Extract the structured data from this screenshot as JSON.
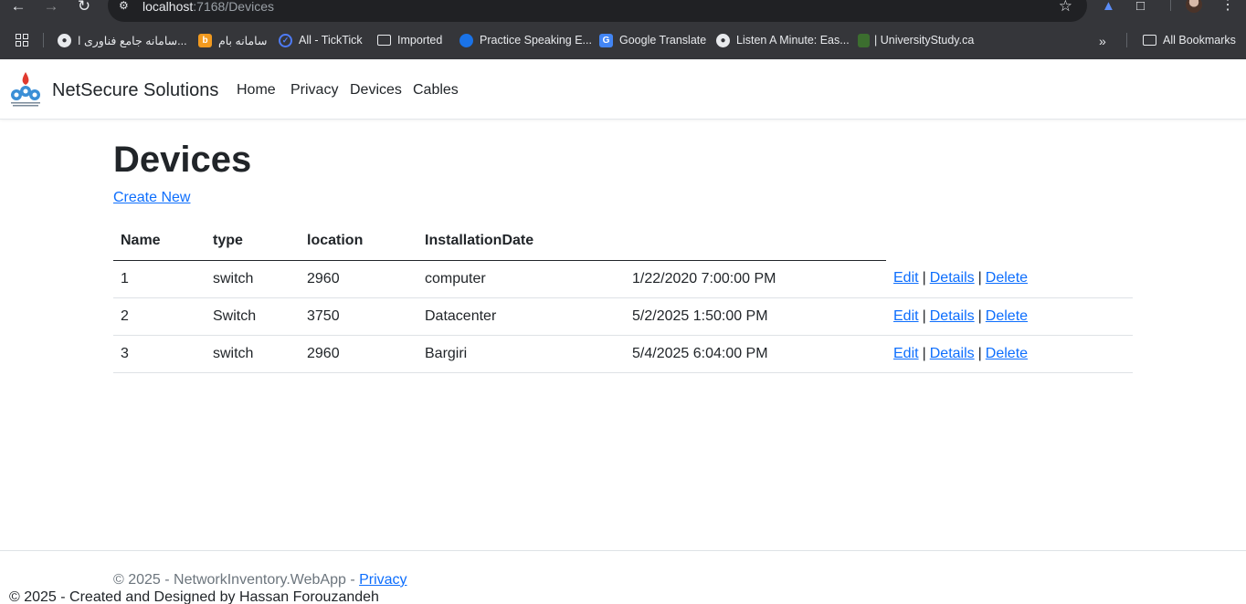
{
  "browser": {
    "url_host": "localhost",
    "url_path": ":7168/Devices",
    "bookmarks": [
      {
        "label": "سامانه جامع فناوری ا...",
        "icon": "globe-icon"
      },
      {
        "label": "سامانه بام",
        "icon": "b-icon"
      },
      {
        "label": "All - TickTick",
        "icon": "ticktick-icon"
      },
      {
        "label": "Imported",
        "icon": "folder-icon"
      },
      {
        "label": "Practice Speaking E...",
        "icon": "blue-circle-icon"
      },
      {
        "label": "Google Translate",
        "icon": "google-translate-icon"
      },
      {
        "label": "Listen A Minute: Eas...",
        "icon": "globe-icon"
      },
      {
        "label": "| UniversityStudy.ca",
        "icon": "graduation-icon"
      }
    ],
    "all_bookmarks": "All Bookmarks"
  },
  "navbar": {
    "brand": "NetSecure Solutions",
    "links": [
      "Home",
      "Privacy",
      "Devices",
      "Cables"
    ]
  },
  "main": {
    "title": "Devices",
    "create_link": "Create New",
    "table": {
      "headers": [
        "Name",
        "type",
        "location",
        "InstallationDate"
      ],
      "rows": [
        {
          "c1": "1",
          "c2": "switch",
          "c3": "2960",
          "c4": "computer",
          "c5": "1/22/2020 7:00:00 PM"
        },
        {
          "c1": "2",
          "c2": "Switch",
          "c3": "3750",
          "c4": "Datacenter",
          "c5": "5/2/2025 1:50:00 PM"
        },
        {
          "c1": "3",
          "c2": "switch",
          "c3": "2960",
          "c4": "Bargiri",
          "c5": "5/4/2025 6:04:00 PM"
        }
      ],
      "actions": {
        "edit": "Edit",
        "details": "Details",
        "delete": "Delete",
        "separator": "|"
      }
    }
  },
  "footer": {
    "copyright": "© 2025 - NetworkInventory.WebApp - ",
    "privacy": "Privacy",
    "credit": "© 2025 - Created and Designed by Hassan Forouzandeh"
  },
  "colors": {
    "link": "#0d6efd",
    "text": "#212529",
    "muted": "#6c757d",
    "chrome_bg": "#35363a"
  }
}
